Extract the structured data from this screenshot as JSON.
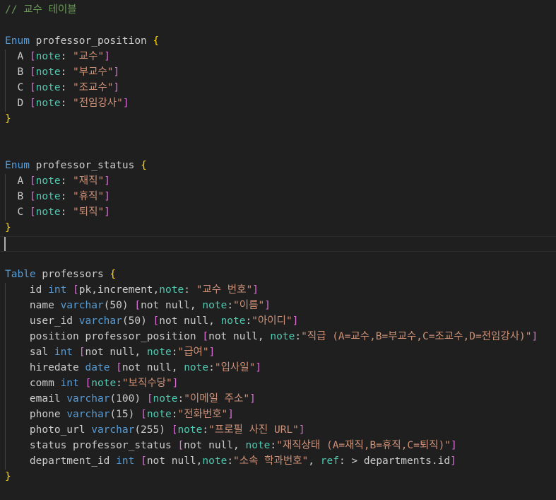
{
  "colors": {
    "background": "#1f1f1f",
    "text": "#cccccc",
    "comment": "#6a9955",
    "keyword": "#569cd6",
    "brace": "#ffd700",
    "bracket": "#da70d6",
    "note_key": "#4ec9b0",
    "string": "#ce9178"
  },
  "lines": [
    [
      {
        "t": "// 교수 테이블",
        "c": "comment"
      }
    ],
    [],
    [
      {
        "t": "Enum",
        "c": "kw"
      },
      {
        "t": " professor_position ",
        "c": "text"
      },
      {
        "t": "{",
        "c": "brace"
      }
    ],
    [
      {
        "t": "  A ",
        "c": "text"
      },
      {
        "t": "[",
        "c": "bracket"
      },
      {
        "t": "note",
        "c": "note"
      },
      {
        "t": ": ",
        "c": "text"
      },
      {
        "t": "\"교수\"",
        "c": "str"
      },
      {
        "t": "]",
        "c": "bracket"
      }
    ],
    [
      {
        "t": "  B ",
        "c": "text"
      },
      {
        "t": "[",
        "c": "bracket"
      },
      {
        "t": "note",
        "c": "note"
      },
      {
        "t": ": ",
        "c": "text"
      },
      {
        "t": "\"부교수\"",
        "c": "str"
      },
      {
        "t": "]",
        "c": "bracket"
      }
    ],
    [
      {
        "t": "  C ",
        "c": "text"
      },
      {
        "t": "[",
        "c": "bracket"
      },
      {
        "t": "note",
        "c": "note"
      },
      {
        "t": ": ",
        "c": "text"
      },
      {
        "t": "\"조교수\"",
        "c": "str"
      },
      {
        "t": "]",
        "c": "bracket"
      }
    ],
    [
      {
        "t": "  D ",
        "c": "text"
      },
      {
        "t": "[",
        "c": "bracket"
      },
      {
        "t": "note",
        "c": "note"
      },
      {
        "t": ": ",
        "c": "text"
      },
      {
        "t": "\"전임강사\"",
        "c": "str"
      },
      {
        "t": "]",
        "c": "bracket"
      }
    ],
    [
      {
        "t": "}",
        "c": "brace"
      }
    ],
    [],
    [],
    [
      {
        "t": "Enum",
        "c": "kw"
      },
      {
        "t": " professor_status ",
        "c": "text"
      },
      {
        "t": "{",
        "c": "brace"
      }
    ],
    [
      {
        "t": "  A ",
        "c": "text"
      },
      {
        "t": "[",
        "c": "bracket"
      },
      {
        "t": "note",
        "c": "note"
      },
      {
        "t": ": ",
        "c": "text"
      },
      {
        "t": "\"재직\"",
        "c": "str"
      },
      {
        "t": "]",
        "c": "bracket"
      }
    ],
    [
      {
        "t": "  B ",
        "c": "text"
      },
      {
        "t": "[",
        "c": "bracket"
      },
      {
        "t": "note",
        "c": "note"
      },
      {
        "t": ": ",
        "c": "text"
      },
      {
        "t": "\"휴직\"",
        "c": "str"
      },
      {
        "t": "]",
        "c": "bracket"
      }
    ],
    [
      {
        "t": "  C ",
        "c": "text"
      },
      {
        "t": "[",
        "c": "bracket"
      },
      {
        "t": "note",
        "c": "note"
      },
      {
        "t": ": ",
        "c": "text"
      },
      {
        "t": "\"퇴직\"",
        "c": "str"
      },
      {
        "t": "]",
        "c": "bracket"
      }
    ],
    [
      {
        "t": "}",
        "c": "brace"
      }
    ],
    [],
    [],
    [
      {
        "t": "Table",
        "c": "kw"
      },
      {
        "t": " professors ",
        "c": "text"
      },
      {
        "t": "{",
        "c": "brace"
      }
    ],
    [
      {
        "t": "    id ",
        "c": "text"
      },
      {
        "t": "int",
        "c": "kw"
      },
      {
        "t": " ",
        "c": "text"
      },
      {
        "t": "[",
        "c": "bracket"
      },
      {
        "t": "pk,increment,",
        "c": "text"
      },
      {
        "t": "note",
        "c": "note"
      },
      {
        "t": ": ",
        "c": "text"
      },
      {
        "t": "\"교수 번호\"",
        "c": "str"
      },
      {
        "t": "]",
        "c": "bracket"
      }
    ],
    [
      {
        "t": "    name ",
        "c": "text"
      },
      {
        "t": "varchar",
        "c": "kw"
      },
      {
        "t": "(50) ",
        "c": "text"
      },
      {
        "t": "[",
        "c": "bracket"
      },
      {
        "t": "not null, ",
        "c": "text"
      },
      {
        "t": "note",
        "c": "note"
      },
      {
        "t": ":",
        "c": "text"
      },
      {
        "t": "\"이름\"",
        "c": "str"
      },
      {
        "t": "]",
        "c": "bracket"
      }
    ],
    [
      {
        "t": "    user_id ",
        "c": "text"
      },
      {
        "t": "varchar",
        "c": "kw"
      },
      {
        "t": "(50) ",
        "c": "text"
      },
      {
        "t": "[",
        "c": "bracket"
      },
      {
        "t": "not null, ",
        "c": "text"
      },
      {
        "t": "note",
        "c": "note"
      },
      {
        "t": ":",
        "c": "text"
      },
      {
        "t": "\"아이디\"",
        "c": "str"
      },
      {
        "t": "]",
        "c": "bracket"
      }
    ],
    [
      {
        "t": "    position professor_position ",
        "c": "text"
      },
      {
        "t": "[",
        "c": "bracket"
      },
      {
        "t": "not null, ",
        "c": "text"
      },
      {
        "t": "note",
        "c": "note"
      },
      {
        "t": ":",
        "c": "text"
      },
      {
        "t": "\"직급 (A=교수,B=부교수,C=조교수,D=전임강사)\"",
        "c": "str"
      },
      {
        "t": "]",
        "c": "bracket"
      }
    ],
    [
      {
        "t": "    sal ",
        "c": "text"
      },
      {
        "t": "int",
        "c": "kw"
      },
      {
        "t": " ",
        "c": "text"
      },
      {
        "t": "[",
        "c": "bracket"
      },
      {
        "t": "not null, ",
        "c": "text"
      },
      {
        "t": "note",
        "c": "note"
      },
      {
        "t": ":",
        "c": "text"
      },
      {
        "t": "\"급여\"",
        "c": "str"
      },
      {
        "t": "]",
        "c": "bracket"
      }
    ],
    [
      {
        "t": "    hiredate ",
        "c": "text"
      },
      {
        "t": "date",
        "c": "kw"
      },
      {
        "t": " ",
        "c": "text"
      },
      {
        "t": "[",
        "c": "bracket"
      },
      {
        "t": "not null, ",
        "c": "text"
      },
      {
        "t": "note",
        "c": "note"
      },
      {
        "t": ":",
        "c": "text"
      },
      {
        "t": "\"입사일\"",
        "c": "str"
      },
      {
        "t": "]",
        "c": "bracket"
      }
    ],
    [
      {
        "t": "    comm ",
        "c": "text"
      },
      {
        "t": "int",
        "c": "kw"
      },
      {
        "t": " ",
        "c": "text"
      },
      {
        "t": "[",
        "c": "bracket"
      },
      {
        "t": "note",
        "c": "note"
      },
      {
        "t": ":",
        "c": "text"
      },
      {
        "t": "\"보직수당\"",
        "c": "str"
      },
      {
        "t": "]",
        "c": "bracket"
      }
    ],
    [
      {
        "t": "    email ",
        "c": "text"
      },
      {
        "t": "varchar",
        "c": "kw"
      },
      {
        "t": "(100) ",
        "c": "text"
      },
      {
        "t": "[",
        "c": "bracket"
      },
      {
        "t": "note",
        "c": "note"
      },
      {
        "t": ":",
        "c": "text"
      },
      {
        "t": "\"이메일 주소\"",
        "c": "str"
      },
      {
        "t": "]",
        "c": "bracket"
      }
    ],
    [
      {
        "t": "    phone ",
        "c": "text"
      },
      {
        "t": "varchar",
        "c": "kw"
      },
      {
        "t": "(15) ",
        "c": "text"
      },
      {
        "t": "[",
        "c": "bracket"
      },
      {
        "t": "note",
        "c": "note"
      },
      {
        "t": ":",
        "c": "text"
      },
      {
        "t": "\"전화번호\"",
        "c": "str"
      },
      {
        "t": "]",
        "c": "bracket"
      }
    ],
    [
      {
        "t": "    photo_url ",
        "c": "text"
      },
      {
        "t": "varchar",
        "c": "kw"
      },
      {
        "t": "(255) ",
        "c": "text"
      },
      {
        "t": "[",
        "c": "bracket"
      },
      {
        "t": "note",
        "c": "note"
      },
      {
        "t": ":",
        "c": "text"
      },
      {
        "t": "\"프로필 사진 URL\"",
        "c": "str"
      },
      {
        "t": "]",
        "c": "bracket"
      }
    ],
    [
      {
        "t": "    status professor_status ",
        "c": "text"
      },
      {
        "t": "[",
        "c": "bracket"
      },
      {
        "t": "not null, ",
        "c": "text"
      },
      {
        "t": "note",
        "c": "note"
      },
      {
        "t": ":",
        "c": "text"
      },
      {
        "t": "\"재직상태 (A=재직,B=휴직,C=퇴직)\"",
        "c": "str"
      },
      {
        "t": "]",
        "c": "bracket"
      }
    ],
    [
      {
        "t": "    department_id ",
        "c": "text"
      },
      {
        "t": "int",
        "c": "kw"
      },
      {
        "t": " ",
        "c": "text"
      },
      {
        "t": "[",
        "c": "bracket"
      },
      {
        "t": "not null,",
        "c": "text"
      },
      {
        "t": "note",
        "c": "note"
      },
      {
        "t": ":",
        "c": "text"
      },
      {
        "t": "\"소속 학과번호\"",
        "c": "str"
      },
      {
        "t": ", ",
        "c": "text"
      },
      {
        "t": "ref",
        "c": "note"
      },
      {
        "t": ": > departments.id",
        "c": "text"
      },
      {
        "t": "]",
        "c": "bracket"
      }
    ],
    [
      {
        "t": "}",
        "c": "brace"
      }
    ]
  ]
}
